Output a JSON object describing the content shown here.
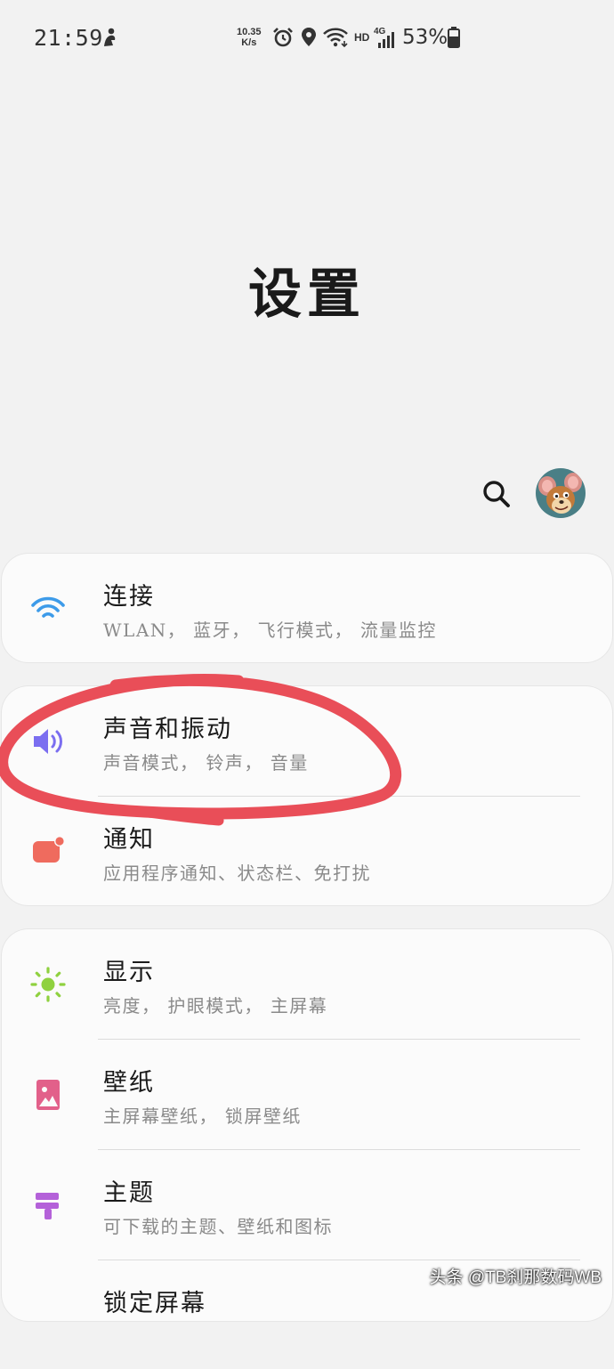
{
  "status_bar": {
    "time": "21:59",
    "net_speed_value": "10.35",
    "net_speed_unit": "K/s",
    "hd": "HD",
    "network": "4G",
    "battery": "53%"
  },
  "page": {
    "title": "设置"
  },
  "header_actions": {
    "search_icon": "search-icon",
    "avatar": "avatar"
  },
  "settings": [
    {
      "title": "连接",
      "subtitle": "WLAN， 蓝牙， 飞行模式， 流量监控",
      "icon": "wifi-icon",
      "color": "#3d9be9"
    },
    {
      "title": "声音和振动",
      "subtitle": "声音模式， 铃声， 音量",
      "icon": "speaker-icon",
      "color": "#7b6ef0"
    },
    {
      "title": "通知",
      "subtitle": "应用程序通知、状态栏、免打扰",
      "icon": "notification-icon",
      "color": "#ef6b5e"
    },
    {
      "title": "显示",
      "subtitle": "亮度， 护眼模式， 主屏幕",
      "icon": "sun-icon",
      "color": "#8fd13f"
    },
    {
      "title": "壁纸",
      "subtitle": "主屏幕壁纸， 锁屏壁纸",
      "icon": "wallpaper-icon",
      "color": "#e2608a"
    },
    {
      "title": "主题",
      "subtitle": "可下载的主题、壁纸和图标",
      "icon": "theme-icon",
      "color": "#b461d9"
    },
    {
      "title": "锁定屏幕",
      "subtitle": "",
      "icon": "lock-icon",
      "color": "#5aa0e8"
    }
  ],
  "annotation_color": "#e94e58",
  "watermark": "头条 @TB刹那数码WB"
}
